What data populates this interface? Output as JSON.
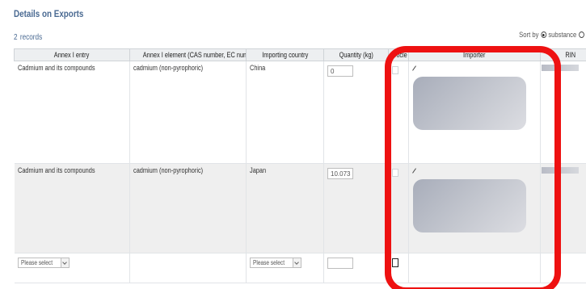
{
  "page": {
    "title": "Details on Exports",
    "records_count": "2",
    "records_label": "records",
    "sort_label": "Sort by",
    "sort_option": "substance"
  },
  "table": {
    "columns": [
      "Annex I entry",
      "Annex I element (CAS number, EC number)",
      "Importing country",
      "Quantity (kg)",
      "Article",
      "Importer",
      "RIN"
    ],
    "rows": [
      {
        "annex_entry": "Cadmium and its compounds",
        "annex_element": "cadmium (non-pyrophoric)",
        "country": "China",
        "quantity": "0",
        "importer_redacted": true,
        "rin_redacted": true
      },
      {
        "annex_entry": "Cadmium and its compounds",
        "annex_element": "cadmium (non-pyrophoric)",
        "country": "Japan",
        "quantity": "10.073",
        "importer_redacted": true,
        "rin_redacted": true
      }
    ],
    "new_row": {
      "annex_entry_placeholder": "Please select",
      "country_placeholder": "Please select",
      "quantity": ""
    }
  },
  "icons": {
    "edit": "pencil-icon",
    "dropdown": "chevron-down-icon",
    "sort_selected": "radio-selected-icon",
    "sort_unselected": "radio-unselected-icon"
  },
  "colors": {
    "title": "#4a6a92",
    "highlight": "#ee1111",
    "header_bg": "#edeff1",
    "alt_row_bg": "#efefef",
    "redaction": "#b4b8c3"
  }
}
